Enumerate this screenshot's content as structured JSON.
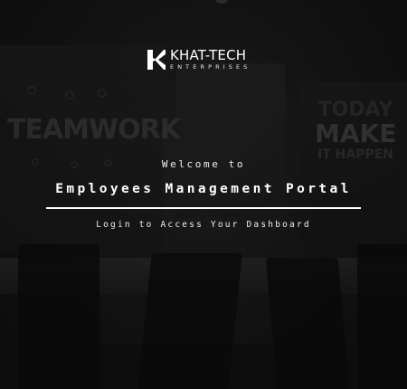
{
  "brand": {
    "name": "KHAT-TECH",
    "tagline": "ENTERPRISES",
    "icon": "k-logo-icon",
    "color": "#ffffff"
  },
  "hero": {
    "welcome": "Welcome to",
    "title": "Employees Management Portal",
    "cta": "Login to Access Your Dashboard"
  },
  "background": {
    "wall_text_left": "TEAMWORK",
    "wall_text_right_1": "TODAY",
    "wall_text_right_2": "MAKE",
    "wall_text_right_3": "IT HAPPEN",
    "overlay_color": "#000000"
  }
}
